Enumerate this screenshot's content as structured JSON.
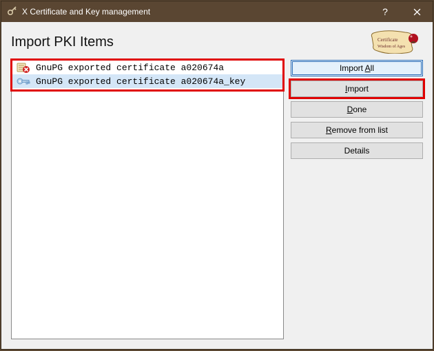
{
  "window": {
    "title": "X Certificate and Key management"
  },
  "page": {
    "title": "Import PKI Items"
  },
  "items": [
    {
      "icon": "cert-error",
      "label": "GnuPG exported certificate a020674a",
      "selected": false
    },
    {
      "icon": "key",
      "label": "GnuPG exported certificate a020674a_key",
      "selected": true
    }
  ],
  "buttons": {
    "import_all_pre": "Import ",
    "import_all_u": "A",
    "import_all_post": "ll",
    "import_u": "I",
    "import_post": "mport",
    "done_u": "D",
    "done_post": "one",
    "remove_u": "R",
    "remove_post": "emove from list",
    "details": "Details"
  }
}
